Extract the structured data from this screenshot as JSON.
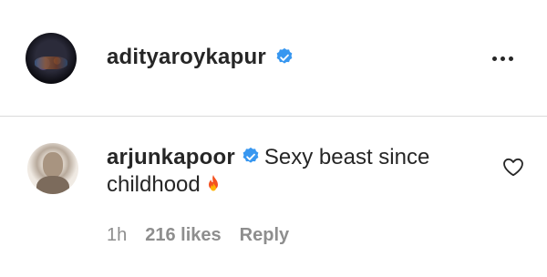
{
  "post": {
    "author": {
      "username": "adityaroykapur",
      "verified": true,
      "avatar_icon": "profile-photo"
    },
    "more_icon": "ellipsis-icon"
  },
  "comment": {
    "username": "arjunkapoor",
    "verified": true,
    "text": "Sexy beast since childhood",
    "emoji": "fire-emoji",
    "time": "1h",
    "likes": "216 likes",
    "reply_label": "Reply",
    "heart_icon": "heart-outline-icon"
  },
  "colors": {
    "verified_badge": "#3897f0",
    "text_primary": "#262626",
    "text_secondary": "#8e8e8e",
    "divider": "#dbdbdb"
  }
}
